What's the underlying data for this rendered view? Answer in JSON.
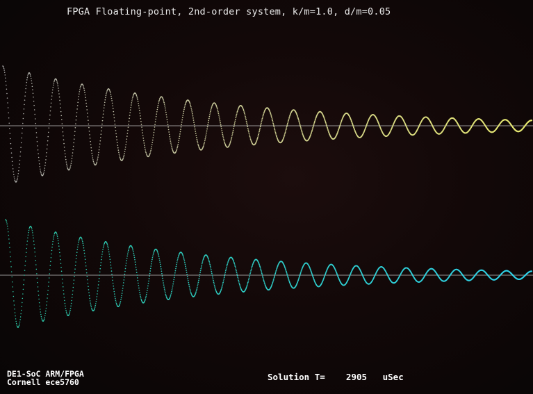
{
  "header": {
    "title": "FPGA Floating-point, 2nd-order system, k/m=1.0, d/m=0.05"
  },
  "footer": {
    "board": "DE1-SoC ARM/FPGA",
    "org": "Cornell ece5760",
    "solution_label": "Solution T=",
    "solution_value": "2905",
    "solution_unit": "uSec"
  },
  "colors": {
    "background": "#100707",
    "baseline": "#b8b8b8",
    "trace1_start": "#b4b4b4",
    "trace1_end": "#e6e870",
    "trace2_start": "#2ec9a6",
    "trace2_end": "#2fd0e8",
    "text": "#ffffff"
  },
  "chart_data": [
    {
      "type": "line",
      "k_over_m": 1.0,
      "d_over_m": 0.05,
      "cycles_visible": 20,
      "initial_amplitude": 1.0,
      "final_amplitude": 0.09,
      "ylim": [
        -1,
        1
      ]
    },
    {
      "type": "line",
      "k_over_m": 1.0,
      "d_over_m": 0.05,
      "cycles_visible": 21,
      "initial_amplitude": 1.0,
      "final_amplitude": 0.07,
      "ylim": [
        -1,
        1
      ]
    }
  ]
}
